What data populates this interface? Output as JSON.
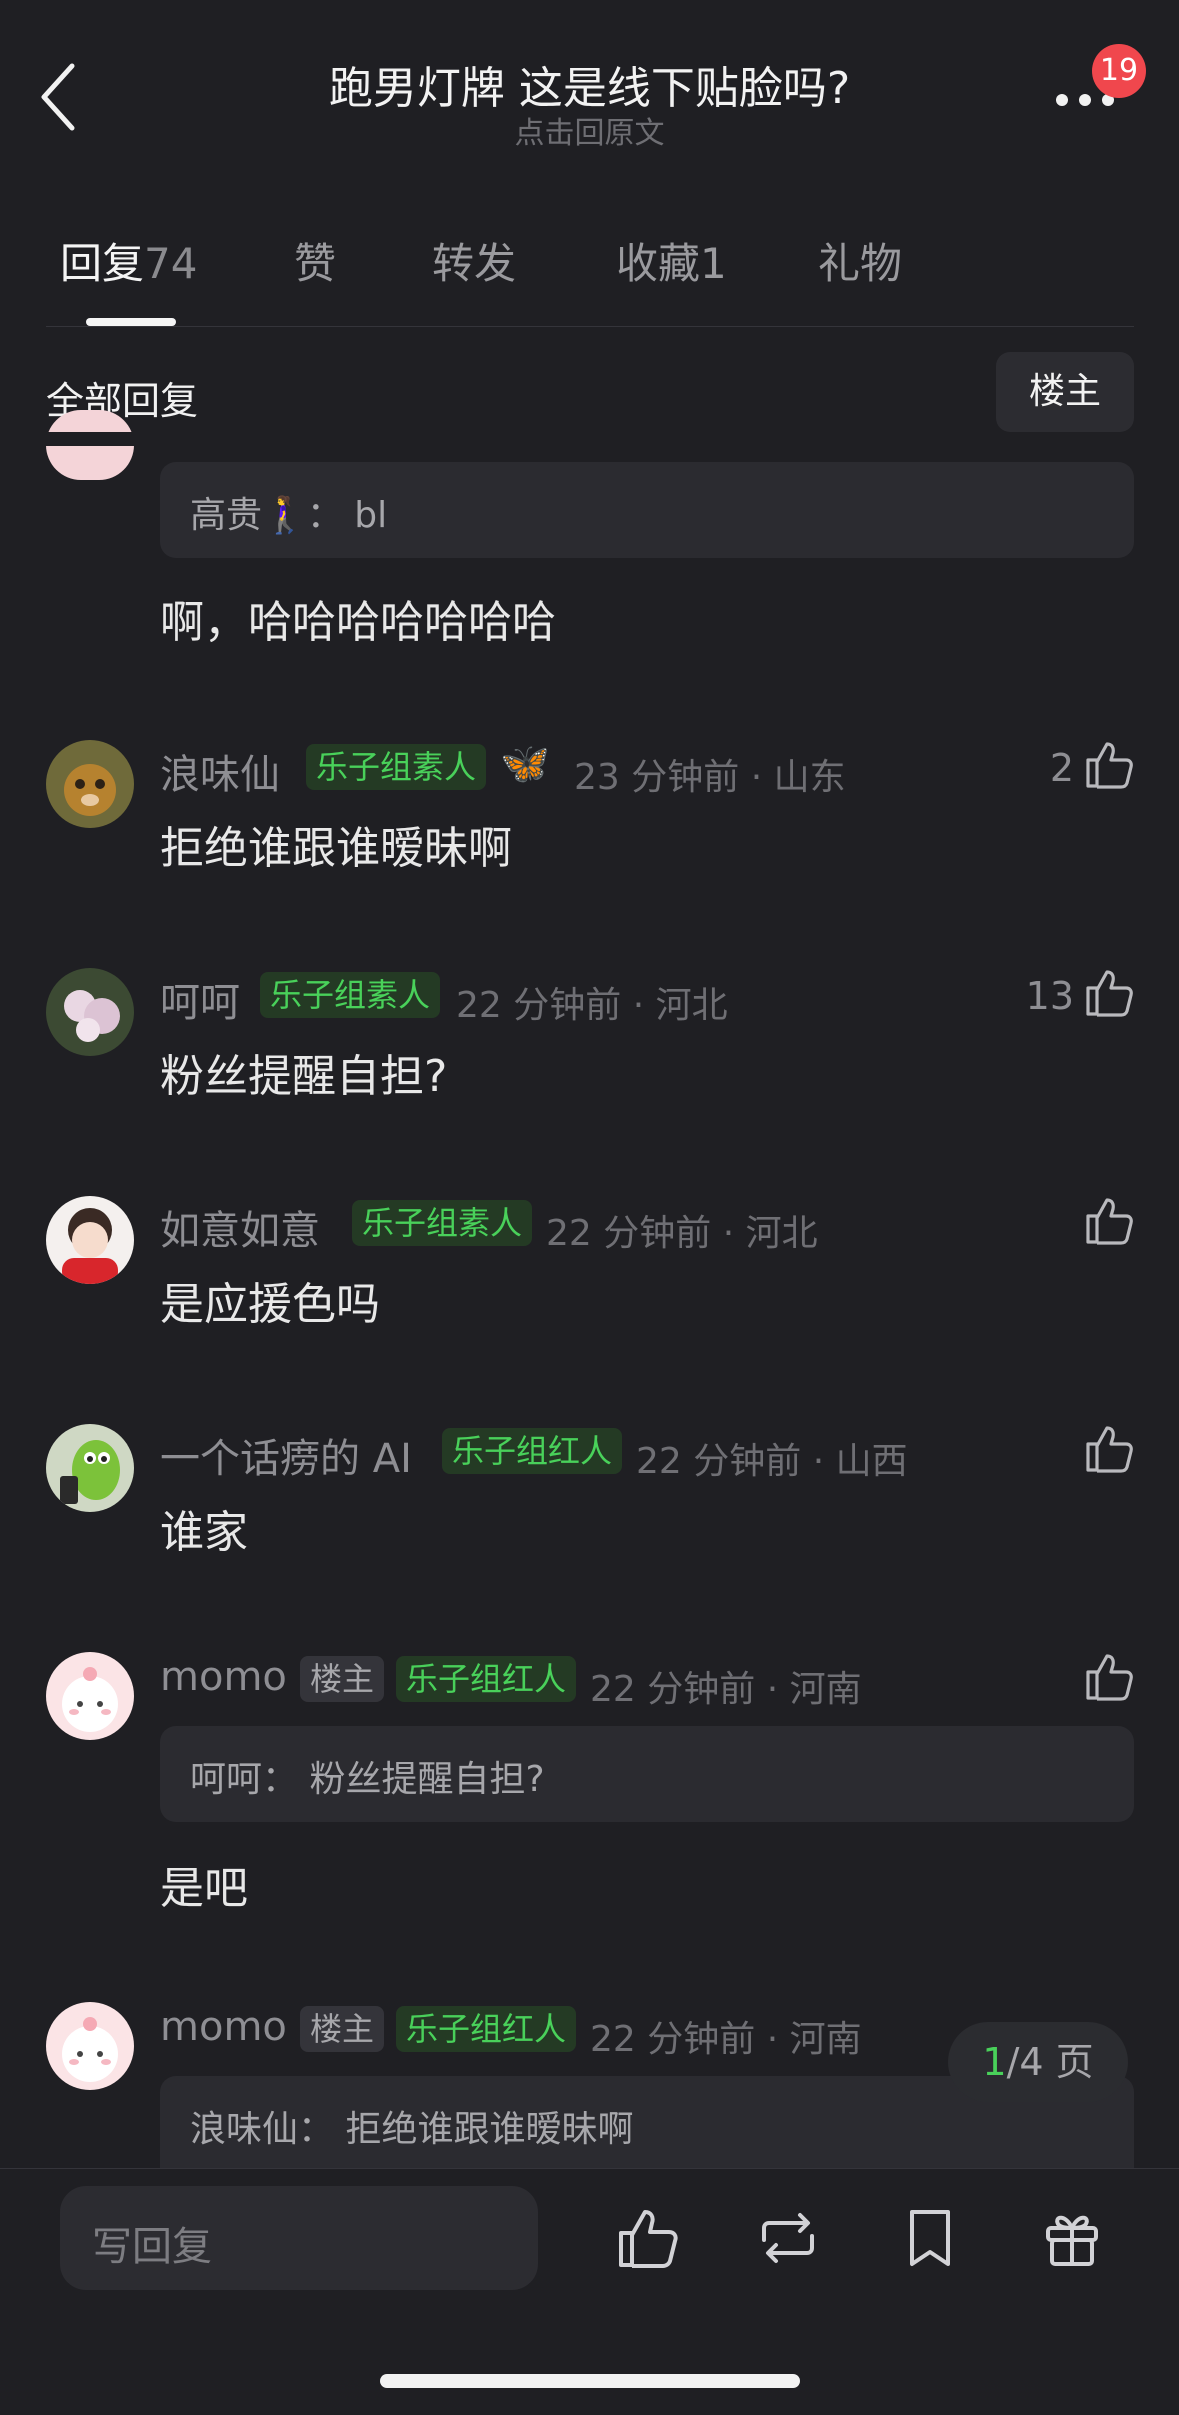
{
  "header": {
    "title": "跑男灯牌  这是线下贴脸吗?",
    "subtitle": "点击回原文",
    "notification_count": "19"
  },
  "tabs": [
    {
      "label": "回复",
      "count": "74"
    },
    {
      "label": "赞",
      "count": ""
    },
    {
      "label": "转发",
      "count": ""
    },
    {
      "label": "收藏",
      "count": "1"
    },
    {
      "label": "礼物",
      "count": ""
    }
  ],
  "filter": {
    "all_replies": "全部回复",
    "op_only": "楼主"
  },
  "comments": [
    {
      "quote": "高贵🚶‍♀️： bl",
      "text": "啊，哈哈哈哈哈哈哈"
    },
    {
      "name": "浪味仙",
      "tags": [
        "乐子组素人"
      ],
      "emoji": "🦋",
      "time": "23 分钟前 · 山东",
      "likes": "2",
      "text": "拒绝谁跟谁暧昧啊"
    },
    {
      "name": "呵呵",
      "tags": [
        "乐子组素人"
      ],
      "time": "22 分钟前 · 河北",
      "likes": "13",
      "text": "粉丝提醒自担?"
    },
    {
      "name": "如意如意",
      "tags": [
        "乐子组素人"
      ],
      "time": "22 分钟前 · 河北",
      "likes": "",
      "text": "是应援色吗"
    },
    {
      "name": "一个话痨的 AI",
      "tags": [
        "乐子组红人"
      ],
      "time": "22 分钟前 · 山西",
      "likes": "",
      "text": "谁家"
    },
    {
      "name": "momo",
      "op_tag": "楼主",
      "tags": [
        "乐子组红人"
      ],
      "time": "22 分钟前 · 河南",
      "likes": "",
      "quote": "呵呵：  粉丝提醒自担?",
      "text": "是吧"
    },
    {
      "name": "momo",
      "op_tag": "楼主",
      "tags": [
        "乐子组红人"
      ],
      "time": "22 分钟前 · 河南",
      "likes": "",
      "quote": "浪味仙：  拒绝谁跟谁暧昧啊"
    }
  ],
  "pagination": {
    "current": "1",
    "total_suffix": "/4 页"
  },
  "bottom_bar": {
    "reply_placeholder": "写回复"
  },
  "icons": [
    "back-icon",
    "more-icon",
    "thumbs-up-icon",
    "repost-icon",
    "bookmark-icon",
    "gift-icon"
  ],
  "colors": {
    "background": "#1f1f23",
    "accent_green": "#49d15a",
    "badge_red": "#f0474d"
  }
}
